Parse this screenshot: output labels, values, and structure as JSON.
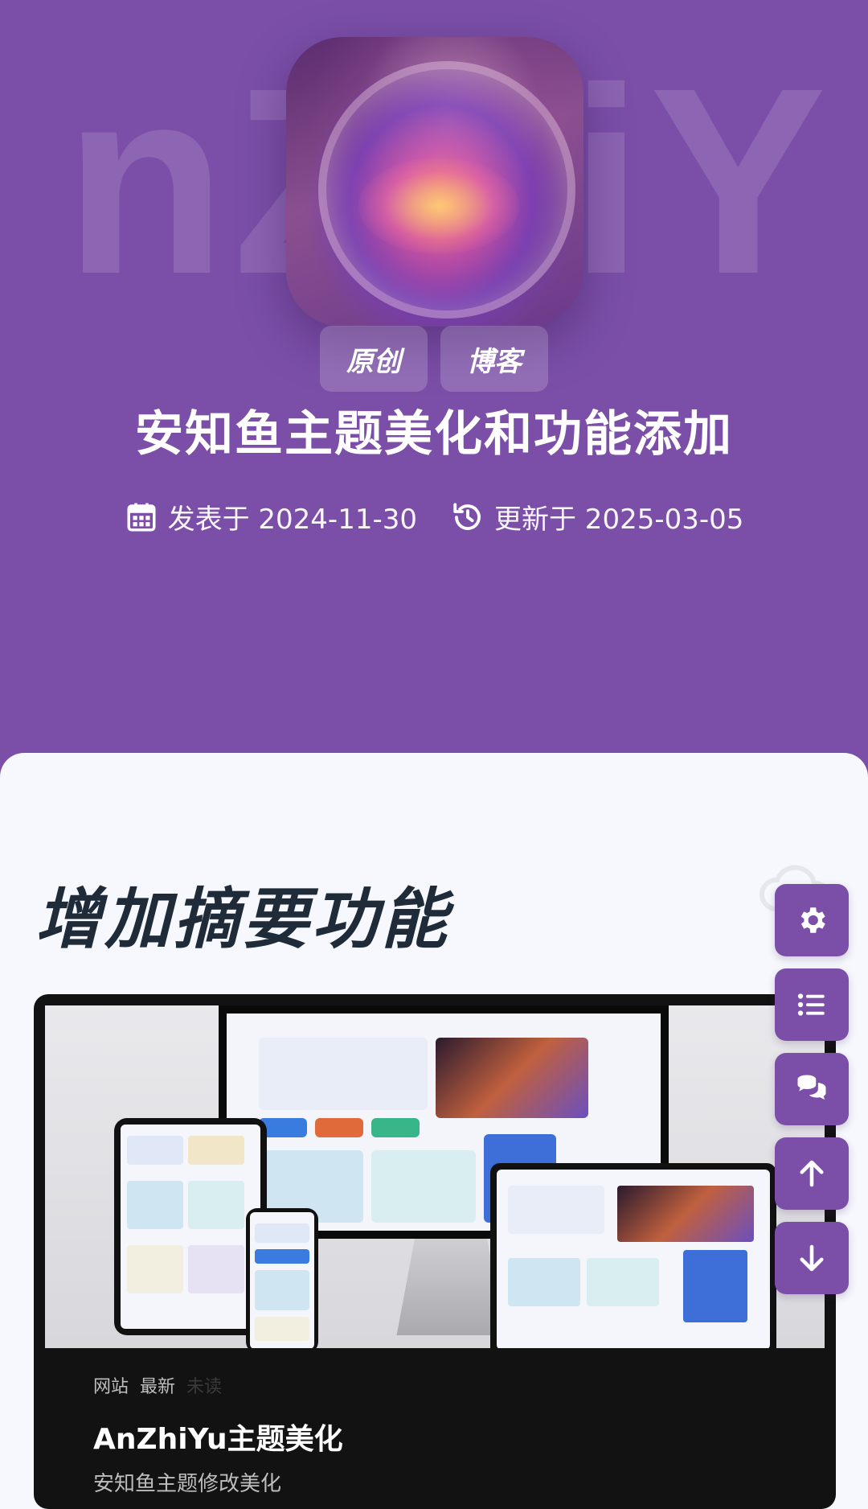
{
  "hero": {
    "watermark": "nZhiY",
    "tags": [
      "原创",
      "博客"
    ],
    "title": "安知鱼主题美化和功能添加",
    "published_label": "发表于 2024-11-30",
    "updated_label": "更新于 2025-03-05",
    "background_color": "#7b4fa8"
  },
  "article": {
    "heading": "增加摘要功能",
    "card": {
      "crumbs": [
        "网站",
        "最新",
        "未读"
      ],
      "title": "AnZhiYu主题美化",
      "subtitle": "安知鱼主题修改美化"
    }
  },
  "side_buttons": [
    {
      "name": "settings",
      "icon": "gear-icon"
    },
    {
      "name": "table-of-contents",
      "icon": "list-icon"
    },
    {
      "name": "comments",
      "icon": "comments-icon"
    },
    {
      "name": "scroll-top",
      "icon": "arrow-up-icon"
    },
    {
      "name": "scroll-bottom",
      "icon": "arrow-down-icon"
    }
  ],
  "colors": {
    "accent": "#7b4fa8",
    "heading_text": "#1f2b38",
    "page_background": "#f6f8fd"
  }
}
